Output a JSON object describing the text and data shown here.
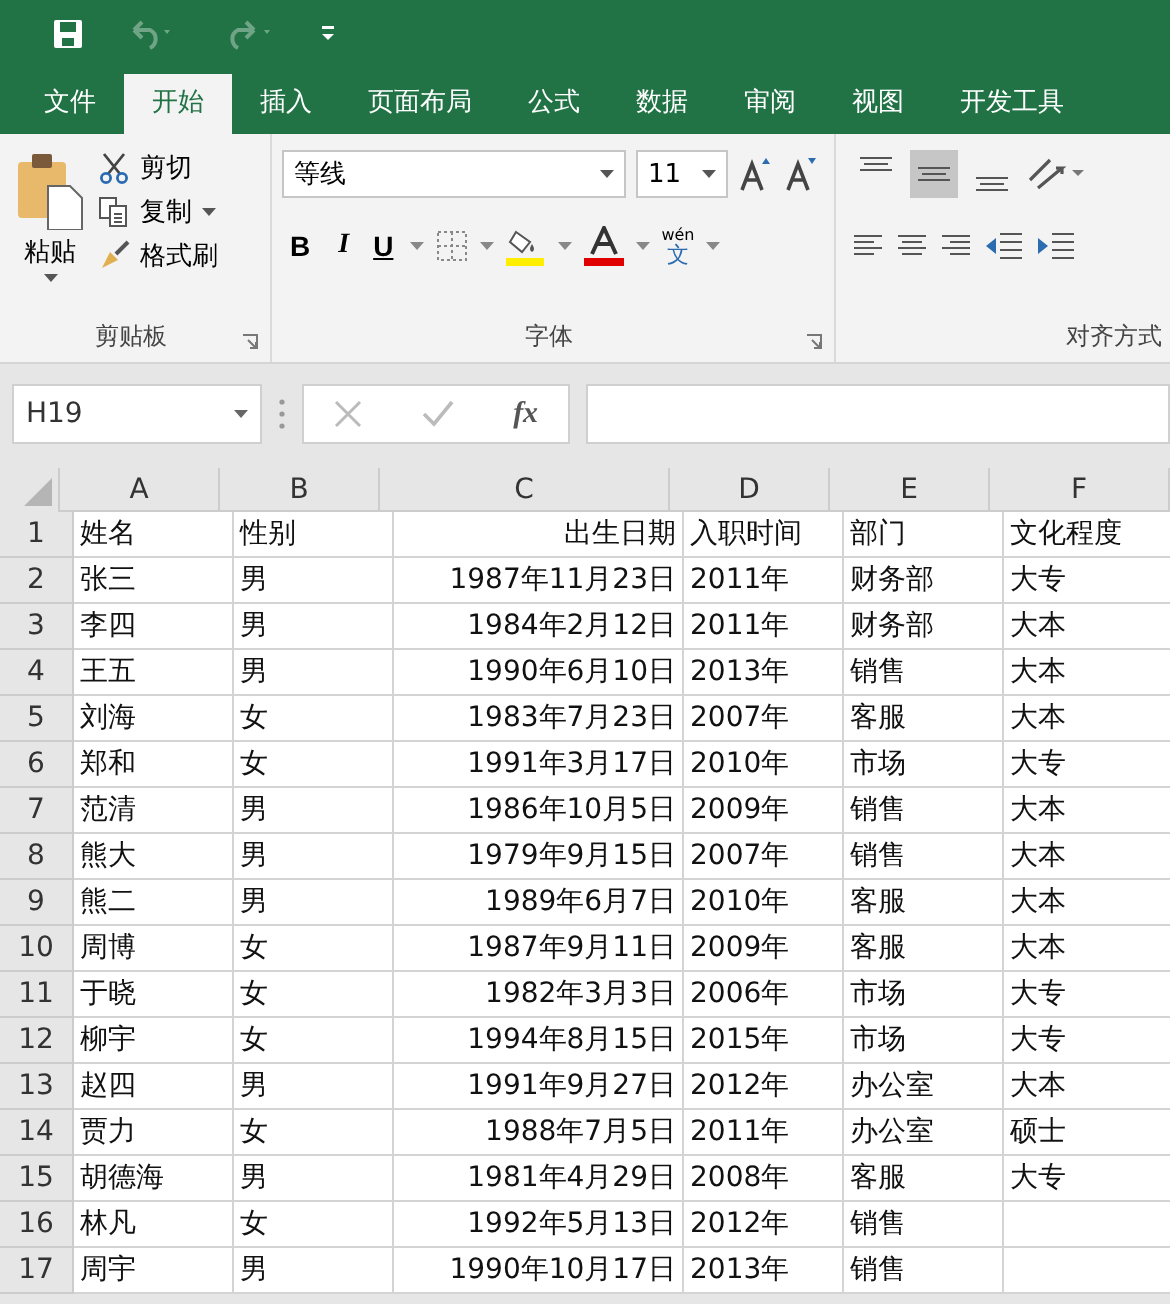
{
  "quick_access": [
    {
      "kind": "save",
      "disabled": false
    },
    {
      "kind": "undo",
      "disabled": true
    },
    {
      "kind": "redo",
      "disabled": true
    },
    {
      "kind": "customize",
      "disabled": false
    }
  ],
  "tabs": [
    {
      "label": "文件",
      "selected": false
    },
    {
      "label": "开始",
      "selected": true
    },
    {
      "label": "插入",
      "selected": false
    },
    {
      "label": "页面布局",
      "selected": false
    },
    {
      "label": "公式",
      "selected": false
    },
    {
      "label": "数据",
      "selected": false
    },
    {
      "label": "审阅",
      "selected": false
    },
    {
      "label": "视图",
      "selected": false
    },
    {
      "label": "开发工具",
      "selected": false
    }
  ],
  "clipboard": {
    "paste": "粘贴",
    "cut": "剪切",
    "copy": "复制",
    "format_painter": "格式刷",
    "label": "剪贴板"
  },
  "font": {
    "bold": "B",
    "italic": "I",
    "underline": "U",
    "name": "等线",
    "size": "11",
    "label": "字体",
    "phonetic": "wén",
    "phonetic_char": "文"
  },
  "alignment": {
    "label": "对齐方式",
    "vertical": [
      {
        "kind": "top",
        "selected": false
      },
      {
        "kind": "middle",
        "selected": true
      },
      {
        "kind": "bottom",
        "selected": false
      }
    ]
  },
  "name_box": "H19",
  "fx": "fx",
  "columns": [
    "A",
    "B",
    "C",
    "D",
    "E",
    "F"
  ],
  "rows": [
    {
      "n": "1",
      "cells": [
        "姓名",
        "性别",
        "出生日期",
        "入职时间",
        "部门",
        "文化程度"
      ]
    },
    {
      "n": "2",
      "cells": [
        "张三",
        "男",
        "1987年11月23日",
        "2011年",
        "财务部",
        "大专"
      ]
    },
    {
      "n": "3",
      "cells": [
        "李四",
        "男",
        "1984年2月12日",
        "2011年",
        "财务部",
        "大本"
      ]
    },
    {
      "n": "4",
      "cells": [
        "王五",
        "男",
        "1990年6月10日",
        "2013年",
        "销售",
        "大本"
      ]
    },
    {
      "n": "5",
      "cells": [
        "刘海",
        "女",
        "1983年7月23日",
        "2007年",
        "客服",
        "大本"
      ]
    },
    {
      "n": "6",
      "cells": [
        "郑和",
        "女",
        "1991年3月17日",
        "2010年",
        "市场",
        "大专"
      ]
    },
    {
      "n": "7",
      "cells": [
        "范清",
        "男",
        "1986年10月5日",
        "2009年",
        "销售",
        "大本"
      ]
    },
    {
      "n": "8",
      "cells": [
        "熊大",
        "男",
        "1979年9月15日",
        "2007年",
        "销售",
        "大本"
      ]
    },
    {
      "n": "9",
      "cells": [
        "熊二",
        "男",
        "1989年6月7日",
        "2010年",
        "客服",
        "大本"
      ]
    },
    {
      "n": "10",
      "cells": [
        "周博",
        "女",
        "1987年9月11日",
        "2009年",
        "客服",
        "大本"
      ]
    },
    {
      "n": "11",
      "cells": [
        "于晓",
        "女",
        "1982年3月3日",
        "2006年",
        "市场",
        "大专"
      ]
    },
    {
      "n": "12",
      "cells": [
        "柳宇",
        "女",
        "1994年8月15日",
        "2015年",
        "市场",
        "大专"
      ]
    },
    {
      "n": "13",
      "cells": [
        "赵四",
        "男",
        "1991年9月27日",
        "2012年",
        "办公室",
        "大本"
      ]
    },
    {
      "n": "14",
      "cells": [
        "贾力",
        "女",
        "1988年7月5日",
        "2011年",
        "办公室",
        "硕士"
      ]
    },
    {
      "n": "15",
      "cells": [
        "胡德海",
        "男",
        "1981年4月29日",
        "2008年",
        "客服",
        "大专"
      ]
    },
    {
      "n": "16",
      "cells": [
        "林凡",
        "女",
        "1992年5月13日",
        "2012年",
        "销售"
      ]
    },
    {
      "n": "17",
      "cells": [
        "周宇",
        "男",
        "1990年10月17日",
        "2013年",
        "销售"
      ]
    }
  ]
}
